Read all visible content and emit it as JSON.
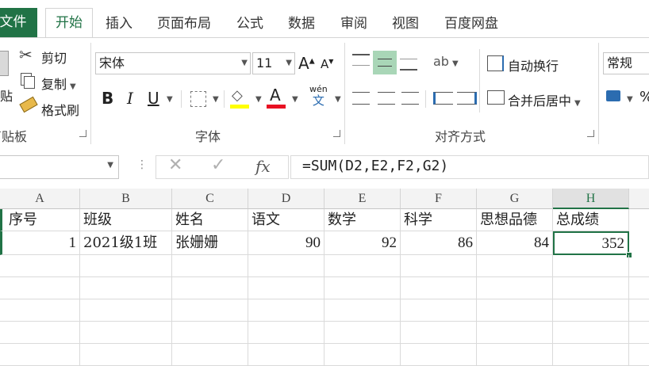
{
  "tabs": [
    {
      "id": "file",
      "label": "文件"
    },
    {
      "id": "home",
      "label": "开始"
    },
    {
      "id": "insert",
      "label": "插入"
    },
    {
      "id": "layout",
      "label": "页面布局"
    },
    {
      "id": "formula",
      "label": "公式"
    },
    {
      "id": "data",
      "label": "数据"
    },
    {
      "id": "review",
      "label": "审阅"
    },
    {
      "id": "view",
      "label": "视图"
    },
    {
      "id": "baidu",
      "label": "百度网盘"
    }
  ],
  "clipboard": {
    "cut": "剪切",
    "copy": "复制",
    "format_painter": "格式刷",
    "paste_partial": "贴",
    "group_label": "剪贴板"
  },
  "font": {
    "name": "宋体",
    "size": "11",
    "group_label": "字体",
    "bold": "B",
    "italic": "I",
    "underline": "U",
    "phonetic_top": "wén",
    "phonetic_bottom": "文",
    "underline_color": "#e81123",
    "highlight_color": "#ffff00"
  },
  "alignment": {
    "wrap": "自动换行",
    "merge": "合并后居中",
    "group_label": "对齐方式"
  },
  "number": {
    "format": "常规",
    "percent": "%"
  },
  "formula_bar": {
    "fx": "fx",
    "formula": "=SUM(D2,E2,F2,G2)"
  },
  "sheet": {
    "columns": [
      "A",
      "B",
      "C",
      "D",
      "E",
      "F",
      "G",
      "H"
    ],
    "rows": [
      [
        "序号",
        "班级",
        "姓名",
        "语文",
        "数学",
        "科学",
        "思想品德",
        "总成绩"
      ],
      [
        "1",
        "2021级1班",
        "张姗姗",
        "90",
        "92",
        "86",
        "84",
        "352"
      ]
    ]
  }
}
